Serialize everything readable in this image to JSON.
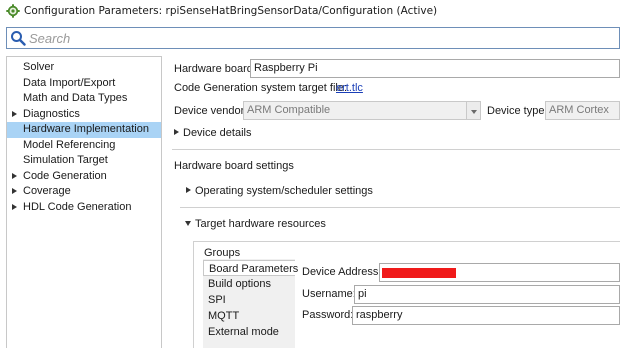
{
  "window": {
    "title": "Configuration Parameters: rpiSenseHatBringSensorData/Configuration (Active)",
    "icon": "gear-icon"
  },
  "search": {
    "placeholder": "Search",
    "icon": "search-icon"
  },
  "sidebar": {
    "items": [
      {
        "label": "Solver",
        "expandable": false,
        "selected": false
      },
      {
        "label": "Data Import/Export",
        "expandable": false,
        "selected": false
      },
      {
        "label": "Math and Data Types",
        "expandable": false,
        "selected": false
      },
      {
        "label": "Diagnostics",
        "expandable": true,
        "selected": false
      },
      {
        "label": "Hardware Implementation",
        "expandable": false,
        "selected": true
      },
      {
        "label": "Model Referencing",
        "expandable": false,
        "selected": false
      },
      {
        "label": "Simulation Target",
        "expandable": false,
        "selected": false
      },
      {
        "label": "Code Generation",
        "expandable": true,
        "selected": false
      },
      {
        "label": "Coverage",
        "expandable": true,
        "selected": false
      },
      {
        "label": "HDL Code Generation",
        "expandable": true,
        "selected": false
      }
    ]
  },
  "main": {
    "hardware_board_label": "Hardware board:",
    "hardware_board_value": "Raspberry Pi",
    "codegen_target_label": "Code Generation system target file:",
    "codegen_target_link": "ert.tlc",
    "device_vendor_label": "Device vendor:",
    "device_vendor_value": "ARM Compatible",
    "device_type_label": "Device type:",
    "device_type_value": "ARM Cortex",
    "device_details_label": "Device details",
    "hw_board_settings_label": "Hardware board settings",
    "os_scheduler_label": "Operating system/scheduler settings",
    "target_hw_resources_label": "Target hardware resources",
    "groups_label": "Groups",
    "groups": [
      {
        "label": "Board Parameters",
        "selected": true
      },
      {
        "label": "Build options",
        "selected": false
      },
      {
        "label": "SPI",
        "selected": false
      },
      {
        "label": "MQTT",
        "selected": false
      },
      {
        "label": "External mode",
        "selected": false
      }
    ],
    "device_address_label": "Device Address:",
    "device_address_value": "",
    "username_label": "Username:",
    "username_value": "pi",
    "password_label": "Password:",
    "password_value": "raspberry"
  },
  "colors": {
    "selection": "#a9d3f5",
    "link": "#1a3fb8",
    "redaction": "#f01a1a"
  }
}
